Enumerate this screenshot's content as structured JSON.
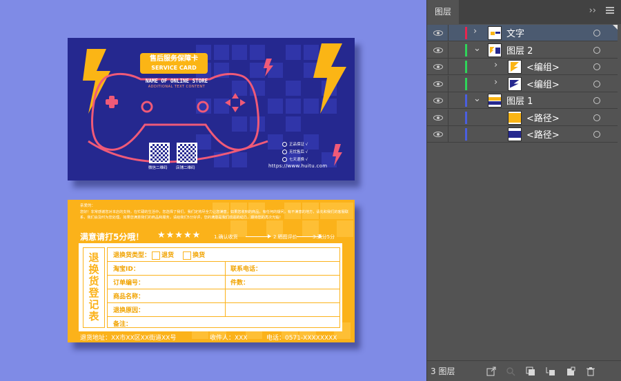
{
  "front_card": {
    "badge_cn": "售后服务保障卡",
    "badge_en": "SERVICE CARD",
    "store_name": "NAME OF ONLINE STORE",
    "store_sub": "ADDITIONAL TEXT CONTENT",
    "qr1_label": "微信二维码",
    "qr2_label": "店铺二维码",
    "benefits": [
      "正品保证 √",
      "无忧售后 √",
      "七天退换 √"
    ],
    "url": "https://www.huitu.com"
  },
  "back_card": {
    "greeting": "亲爱的：",
    "paragraph": "您好！非常感谢您对本店的支持，在忙碌的生活中，您选择了我们，我们定将尽全力让您满意，如果您收到的商品，有任何的疑问，有不满意的地方，请先和我们的客服联系，我们会及时为您处理。如果您满意我们的商品和服务，请给我们5分好评，您的满意是我们前进的动力，期待您的再次光临！",
    "satisfaction": "满意请打5分哦！",
    "stars": "★★★★★",
    "steps": [
      "1.确认收货",
      "2.晒图评价",
      "3.满分5分"
    ],
    "side_title": "退换货登记表",
    "type_label": "退换货类型：",
    "option_return": "退货",
    "option_exchange": "换货",
    "fields": {
      "taobao_id": "淘宝ID：",
      "phone": "联系电话：",
      "order_no": "订单编号：",
      "pieces": "件数：",
      "product_name": "商品名称：",
      "reason": "退换原因：",
      "remark": "备注："
    },
    "footer_address": "退货地址：XX市XX区XX街道XX号",
    "footer_receiver": "收件人：XXX",
    "footer_phone": "电话：0571-XXXXXXXX"
  },
  "layers_panel": {
    "tab_title": "图层",
    "layers": [
      {
        "name": "文字",
        "indent": 0,
        "expandable": true,
        "expanded": false,
        "color": "#e8264f",
        "selected": true
      },
      {
        "name": "图层 2",
        "indent": 0,
        "expandable": true,
        "expanded": true,
        "color": "#2fd45a",
        "selected": false
      },
      {
        "name": "<编组>",
        "indent": 1,
        "expandable": true,
        "expanded": false,
        "color": "#2fd45a",
        "selected": false
      },
      {
        "name": "<编组>",
        "indent": 1,
        "expandable": true,
        "expanded": false,
        "color": "#2fd45a",
        "selected": false
      },
      {
        "name": "图层 1",
        "indent": 0,
        "expandable": true,
        "expanded": true,
        "color": "#4a5fe0",
        "selected": false
      },
      {
        "name": "<路径>",
        "indent": 1,
        "expandable": false,
        "expanded": false,
        "color": "#4a5fe0",
        "selected": false
      },
      {
        "name": "<路径>",
        "indent": 1,
        "expandable": false,
        "expanded": false,
        "color": "#4a5fe0",
        "selected": false
      }
    ],
    "layer_count": "3 图层"
  },
  "colors": {
    "canvas_bg": "#7f8be6",
    "card_navy": "#25288f",
    "card_orange": "#fbb21a",
    "accent_pink": "#ef5a78",
    "panel_bg": "#535353"
  }
}
